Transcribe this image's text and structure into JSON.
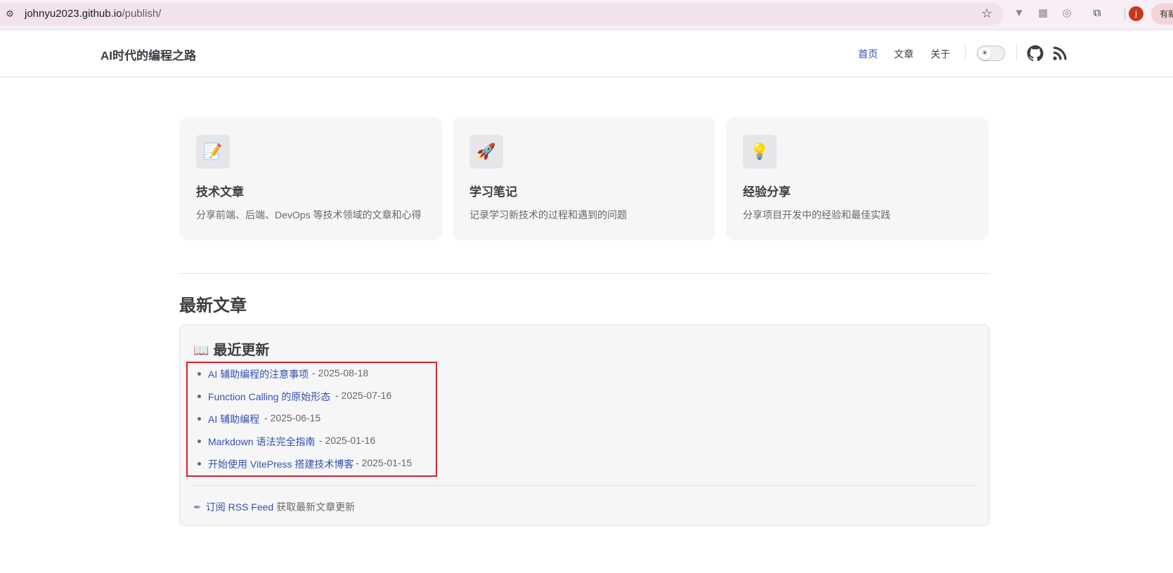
{
  "browser": {
    "url_host": "johnyu2023.github.io",
    "url_path": "/publish/",
    "profile_initial": "j",
    "update_label": "有新"
  },
  "nav": {
    "site_title": "AI时代的编程之路",
    "links": [
      "首页",
      "文章",
      "关于"
    ],
    "active_index": 0
  },
  "features": [
    {
      "icon": "📝",
      "icon_name": "memo-icon",
      "title": "技术文章",
      "desc": "分享前端、后端、DevOps 等技术领域的文章和心得"
    },
    {
      "icon": "🚀",
      "icon_name": "rocket-icon",
      "title": "学习笔记",
      "desc": "记录学习新技术的过程和遇到的问题"
    },
    {
      "icon": "💡",
      "icon_name": "lightbulb-icon",
      "title": "经验分享",
      "desc": "分享项目开发中的经验和最佳实践"
    }
  ],
  "latest": {
    "heading": "最新文章",
    "box_title": "最近更新",
    "book_icon": "📖",
    "posts": [
      {
        "title": "AI 辅助编程的注意事项",
        "date": " - 2025-08-18"
      },
      {
        "title": "Function Calling 的原始形态",
        "date": " - 2025-07-16"
      },
      {
        "title": "AI 辅助编程",
        "date": " - 2025-06-15"
      },
      {
        "title": "Markdown 语法完全指南",
        "date": " - 2025-01-16"
      },
      {
        "title": "开始使用 VitePress 搭建技术博客",
        "date": " - 2025-01-15"
      }
    ],
    "rss_link": "订阅 RSS Feed",
    "rss_suffix": " 获取最新文章更新"
  },
  "colors": {
    "brand": "#3451b2",
    "highlight": "#d9202a",
    "card_bg": "#f6f6f7"
  }
}
